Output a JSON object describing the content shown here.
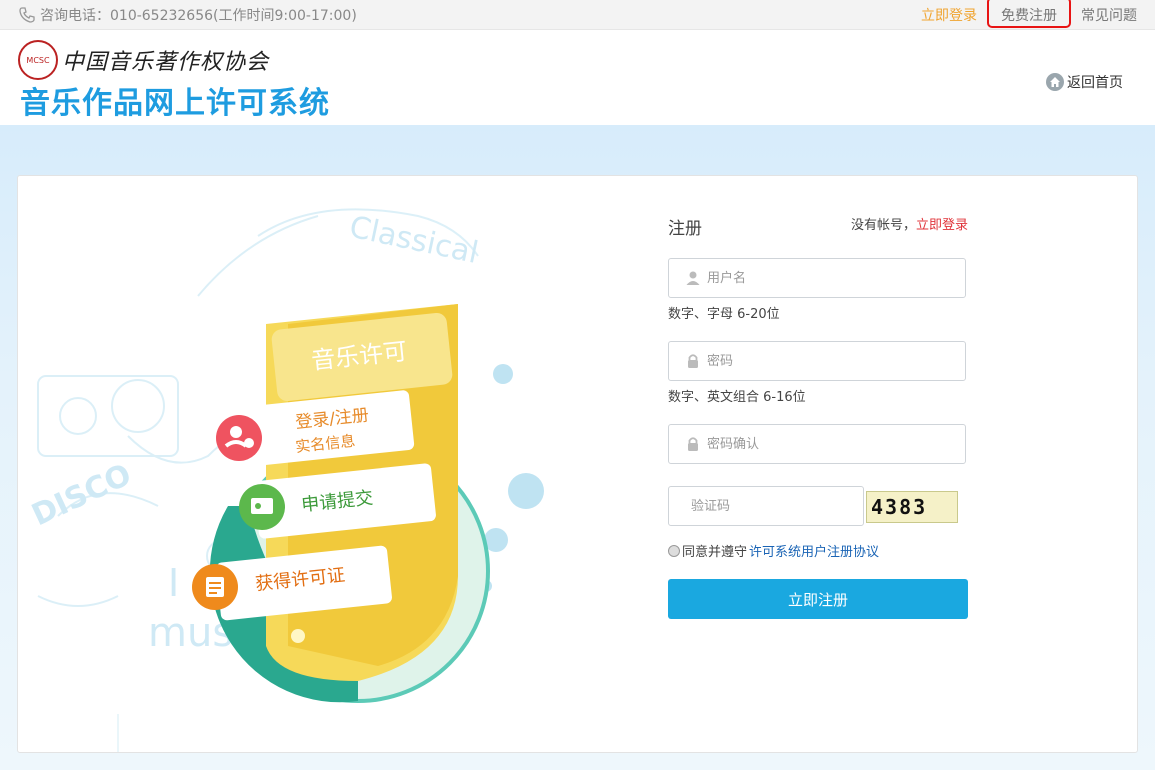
{
  "topbar": {
    "phone_text": "咨询电话：010-65232656(工作时间9:00-17:00)",
    "login_link": "立即登录",
    "register_link": "免费注册",
    "faq_link": "常见问题"
  },
  "header": {
    "org_name": "中国音乐著作权协会",
    "logo_mark": "MCSC",
    "site_title": "音乐作品网上许可系统",
    "home_link": "返回首页"
  },
  "illustration": {
    "card_title": "音乐许可",
    "step1_line1": "登录/注册",
    "step1_line2": "实名信息",
    "step2": "申请提交",
    "step3": "获得许可证",
    "deco_words": [
      "Classical",
      "DISCO",
      "I",
      "music"
    ]
  },
  "form": {
    "title": "注册",
    "hint_prefix": "没有帐号，",
    "hint_link": "立即登录",
    "username_placeholder": "用户名",
    "username_tip": "数字、字母 6-20位",
    "password_placeholder": "密码",
    "password_tip": "数字、英文组合 6-16位",
    "confirm_placeholder": "密码确认",
    "captcha_placeholder": "验证码",
    "captcha_text": "4383",
    "agree_prefix": "同意并遵守",
    "agree_link": "许可系统用户注册协议",
    "submit_label": "立即注册"
  },
  "colors": {
    "accent_blue": "#1aa8e0",
    "title_blue": "#1e9ce0",
    "link_orange": "#f0a430",
    "link_red": "#e0343a",
    "highlight_red": "#e81414"
  }
}
